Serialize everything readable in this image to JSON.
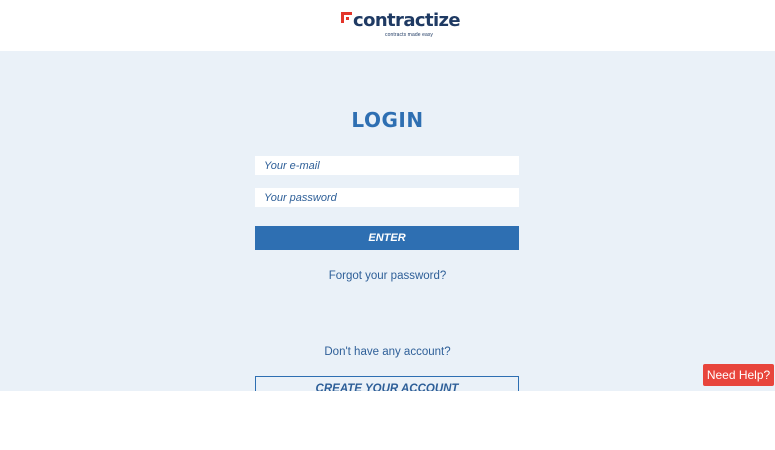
{
  "header": {
    "logo_text": "contractize",
    "logo_tagline": "contracts made easy",
    "brand_color": "#1f3a63",
    "logo_mark_color": "#e3352a",
    "logo_mark_icon": "contractize-logo-mark-icon"
  },
  "login": {
    "title": "LOGIN",
    "email_placeholder": "Your e-mail",
    "email_value": "",
    "password_placeholder": "Your password",
    "password_value": "",
    "enter_label": "ENTER",
    "forgot_label": "Forgot your password?",
    "no_account_label": "Don't have any account?",
    "create_label": "CREATE YOUR ACCOUNT",
    "accent_color": "#2e6fb2",
    "background_color": "#eaf1f8"
  },
  "help": {
    "label": "Need Help?",
    "color": "#e8453c"
  }
}
